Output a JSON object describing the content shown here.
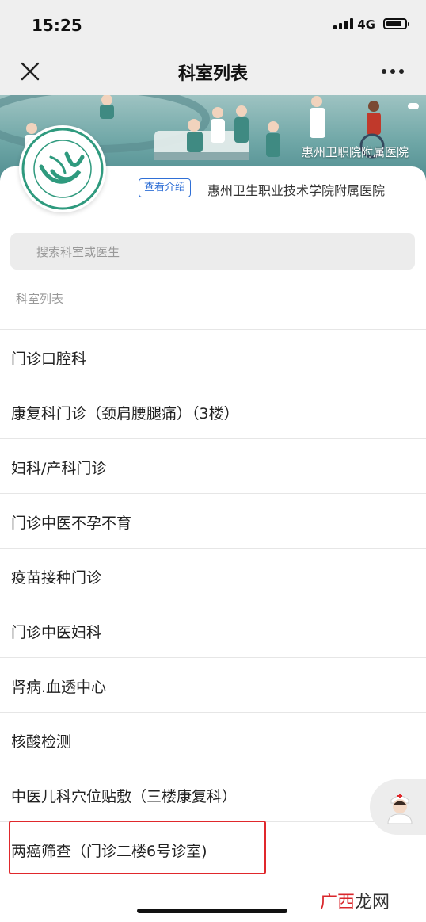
{
  "status": {
    "time": "15:25",
    "network": "4G"
  },
  "nav": {
    "title": "科室列表",
    "close_icon": "close-icon",
    "more_icon": "more-dots-icon"
  },
  "banner": {
    "name": "惠州卫职院附属医院"
  },
  "hospital": {
    "intro_label": "查看介绍",
    "name": "惠州卫生职业技术学院附属医院"
  },
  "search": {
    "placeholder": "搜索科室或医生"
  },
  "section_title": "科室列表",
  "departments": [
    "门诊口腔科",
    "康复科门诊（颈肩腰腿痛）（3楼）",
    "妇科/产科门诊",
    "门诊中医不孕不育",
    "疫苗接种门诊",
    "门诊中医妇科",
    "肾病.血透中心",
    "核酸检测",
    "中医儿科穴位贴敷（三楼康复科）",
    "两癌筛查（门诊二楼6号诊室)"
  ],
  "watermark": {
    "part1": "广西",
    "part2": "龙网"
  },
  "colors": {
    "accent": "#2f6fd6",
    "highlight": "#e0282c",
    "banner": "#6ea6a6"
  }
}
